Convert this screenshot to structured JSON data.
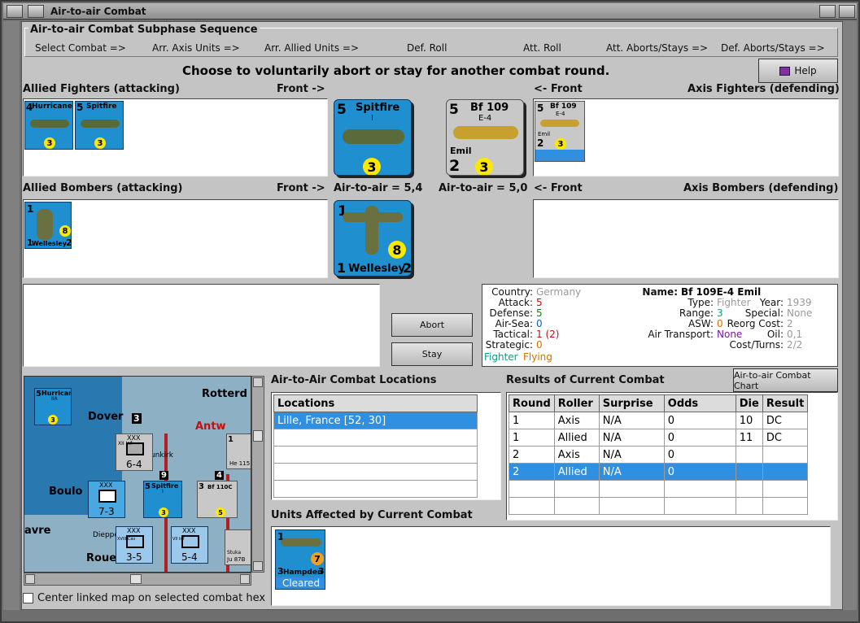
{
  "window": {
    "title": "Air-to-air Combat"
  },
  "sequence": {
    "group_title": "Air-to-air Combat Subphase Sequence",
    "steps": [
      "Select Combat =>",
      "Arr. Axis Units =>",
      "Arr. Allied Units =>",
      "Def. Roll",
      "Att. Roll",
      "Att. Aborts/Stays =>",
      "Def. Aborts/Stays =>"
    ]
  },
  "prompt": "Choose to voluntarily abort or stay for another combat round.",
  "help_label": "Help",
  "labels": {
    "allied_fighters": "Allied Fighters (attacking)",
    "front_right": "Front ->",
    "front_left": "<- Front",
    "axis_fighters": "Axis Fighters (defending)",
    "allied_bombers": "Allied Bombers (attacking)",
    "air_to_air_allied": "Air-to-air = 5,4",
    "air_to_air_axis": "Air-to-air = 5,0",
    "axis_bombers": "Axis Bombers (defending)"
  },
  "allied_fighters": [
    {
      "name": "Hurricane",
      "attack": "4",
      "def": "3"
    },
    {
      "name": "Spitfire",
      "attack": "5",
      "def": "3"
    }
  ],
  "big_spitfire": {
    "name": "Spitfire",
    "sub": "I",
    "attack": "5",
    "def": "3"
  },
  "big_bf109": {
    "name": "Bf 109",
    "sub": "E-4",
    "nick": "Emil",
    "attack": "5",
    "left": "2",
    "def": "3"
  },
  "axis_fighter_small": {
    "name": "Bf 109",
    "sub": "E-4",
    "nick": "Emil",
    "attack": "5",
    "left": "2",
    "def": "3"
  },
  "allied_bomber_small": {
    "name": "Wellesley",
    "top": "1",
    "left": "1",
    "right": "2",
    "def": "8"
  },
  "big_wellesley": {
    "name": "Wellesley",
    "top": "1",
    "left": "1",
    "right": "2",
    "def": "8"
  },
  "buttons": {
    "abort": "Abort",
    "stay": "Stay",
    "chart": "Air-to-air Combat Chart"
  },
  "info": {
    "country_k": "Country:",
    "country_v": "Germany",
    "attack_k": "Attack:",
    "attack_v": "5",
    "defense_k": "Defense:",
    "defense_v": "5",
    "airsea_k": "Air-Sea:",
    "airsea_v": "0",
    "tactical_k": "Tactical:",
    "tactical_v": "1 (2)",
    "strategic_k": "Strategic:",
    "strategic_v": "0",
    "tag1": "Fighter",
    "tag2": "Flying",
    "name_k": "Name:",
    "name_v": "Bf 109E-4 Emil",
    "type_k": "Type:",
    "type_v": "Fighter",
    "range_k": "Range:",
    "range_v": "3",
    "asw_k": "ASW:",
    "asw_v": "0",
    "airtrans_k": "Air Transport:",
    "airtrans_v": "None",
    "year_k": "Year:",
    "year_v": "1939",
    "special_k": "Special:",
    "special_v": "None",
    "reorg_k": "Reorg Cost:",
    "reorg_v": "2",
    "oil_k": "Oil:",
    "oil_v": "0,1",
    "cost_k": "Cost/Turns:",
    "cost_v": "2/2",
    "colors": {
      "germany": "#9a9a9a",
      "red": "#c01010",
      "green": "#108010",
      "blue": "#1060c0",
      "orange": "#d07000",
      "purple": "#8010a0",
      "teal": "#10a080"
    }
  },
  "locations": {
    "title": "Air-to-Air Combat Locations",
    "header": "Locations",
    "rows": [
      "Lille, France [52, 30]",
      "",
      "",
      "",
      ""
    ]
  },
  "results": {
    "title": "Results of Current Combat",
    "headers": [
      "Round",
      "Roller",
      "Surprise",
      "Odds",
      "Die",
      "Result"
    ],
    "rows": [
      [
        "1",
        "Axis",
        "N/A",
        "0",
        "10",
        "DC"
      ],
      [
        "1",
        "Allied",
        "N/A",
        "0",
        "11",
        "DC"
      ],
      [
        "2",
        "Axis",
        "N/A",
        "0",
        "",
        ""
      ],
      [
        "2",
        "Allied",
        "N/A",
        "0",
        "",
        ""
      ],
      [
        "",
        "",
        "",
        "",
        "",
        ""
      ],
      [
        "",
        "",
        "",
        "",
        "",
        ""
      ]
    ]
  },
  "units_affected": {
    "title": "Units Affected by Current Combat",
    "unit": {
      "name": "Hampden",
      "top": "1",
      "left": "3",
      "right": "3",
      "def": "7",
      "status": "Cleared"
    }
  },
  "map": {
    "labels": [
      "Dover",
      "Rotterd",
      "Antw",
      "Boulo",
      "Dunkirk",
      "Dieppe",
      "Roue",
      "avre"
    ],
    "units": [
      {
        "top": "XXX",
        "side": "XII Inf",
        "val": "6-4"
      },
      {
        "top": "XXX",
        "side": "",
        "val": "7-3"
      },
      {
        "top": "XXX",
        "side": "XVIII Cav",
        "val": "3-5"
      },
      {
        "top": "XXX",
        "side": "VII Inf",
        "val": "5-4"
      }
    ],
    "air": [
      {
        "name": "Hurricane",
        "sub": "IIA",
        "n": "5",
        "d": "3"
      },
      {
        "name": "Spitfire",
        "sub": "I",
        "n": "5",
        "d": "3"
      },
      {
        "name": "Bf 110C",
        "n": "3",
        "d": "5"
      }
    ],
    "extras": [
      "3",
      "9",
      "4",
      "1",
      "He 115",
      "Stuka",
      "Ju 87B"
    ]
  },
  "checkbox_label": "Center linked map on selected combat hex"
}
